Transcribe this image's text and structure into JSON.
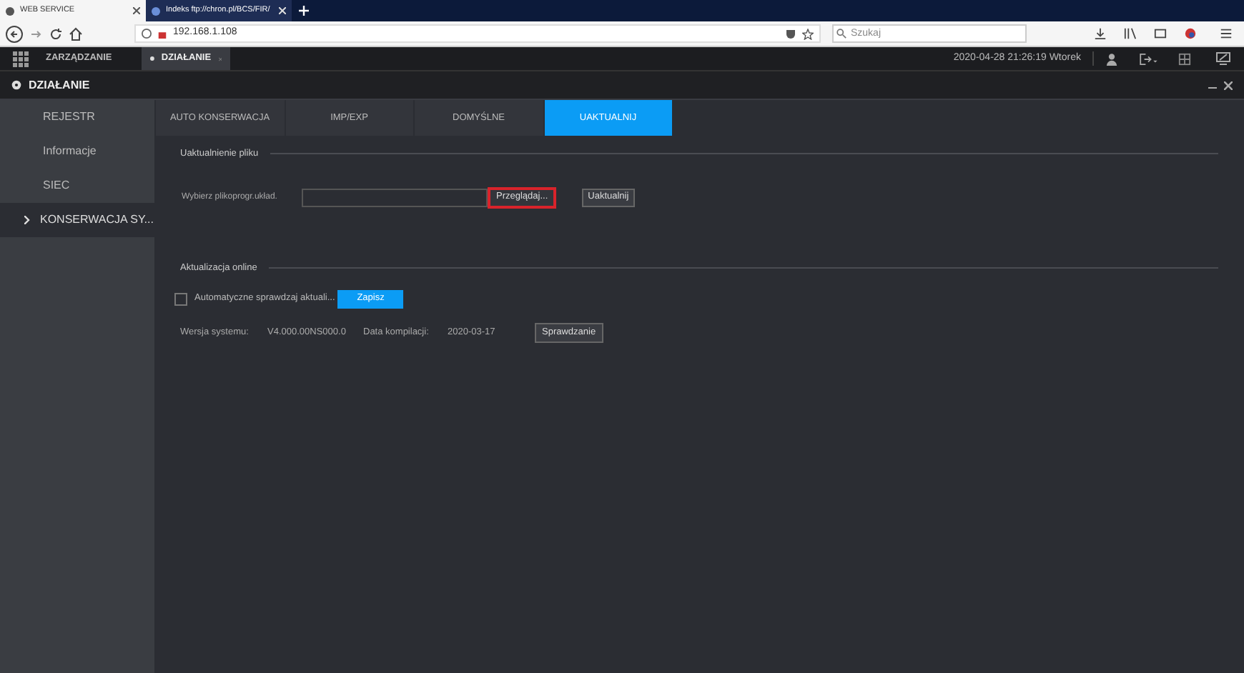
{
  "browser": {
    "tabs": [
      {
        "title": "WEB SERVICE",
        "selected": true
      },
      {
        "title": "Indeks ftp://chron.pl/BCS/FIR/",
        "selected": false
      }
    ],
    "address": "192.168.1.108",
    "search": {
      "placeholder": "Szukaj"
    }
  },
  "app_bar": {
    "menu": [
      {
        "label": "ZARZĄDZANIE",
        "selected": false
      },
      {
        "label": "DZIAŁANIE",
        "selected": true
      }
    ],
    "datetime": "2020-04-28 21:26:19 Wtorek"
  },
  "panel": {
    "title": "DZIAŁANIE"
  },
  "sidebar": {
    "items": [
      {
        "label": "REJESTR",
        "selected": false
      },
      {
        "label": "Informacje",
        "selected": false
      },
      {
        "label": "SIEC",
        "selected": false
      },
      {
        "label": "KONSERWACJA SY...",
        "selected": true
      }
    ]
  },
  "tabs": [
    {
      "label": "AUTO KONSERWACJA",
      "selected": false
    },
    {
      "label": "IMP/EXP",
      "selected": false
    },
    {
      "label": "DOMYŚLNE",
      "selected": false
    },
    {
      "label": "UAKTUALNIJ",
      "selected": true
    }
  ],
  "file_update": {
    "heading": "Uaktualnienie pliku",
    "label": "Wybierz plikoprogr.układ.",
    "browse": "Przeglądaj...",
    "update": "Uaktualnij"
  },
  "online_update": {
    "heading": "Aktualizacja online",
    "auto_check": {
      "label": "Automatyczne sprawdzaj aktuali...",
      "checked": false
    },
    "save": "Zapisz",
    "version_label": "Wersja systemu:",
    "version": "V4.000.00NS000.0",
    "build_label": "Data kompilacji:",
    "build": "2020-03-17",
    "check": "Sprawdzanie"
  }
}
